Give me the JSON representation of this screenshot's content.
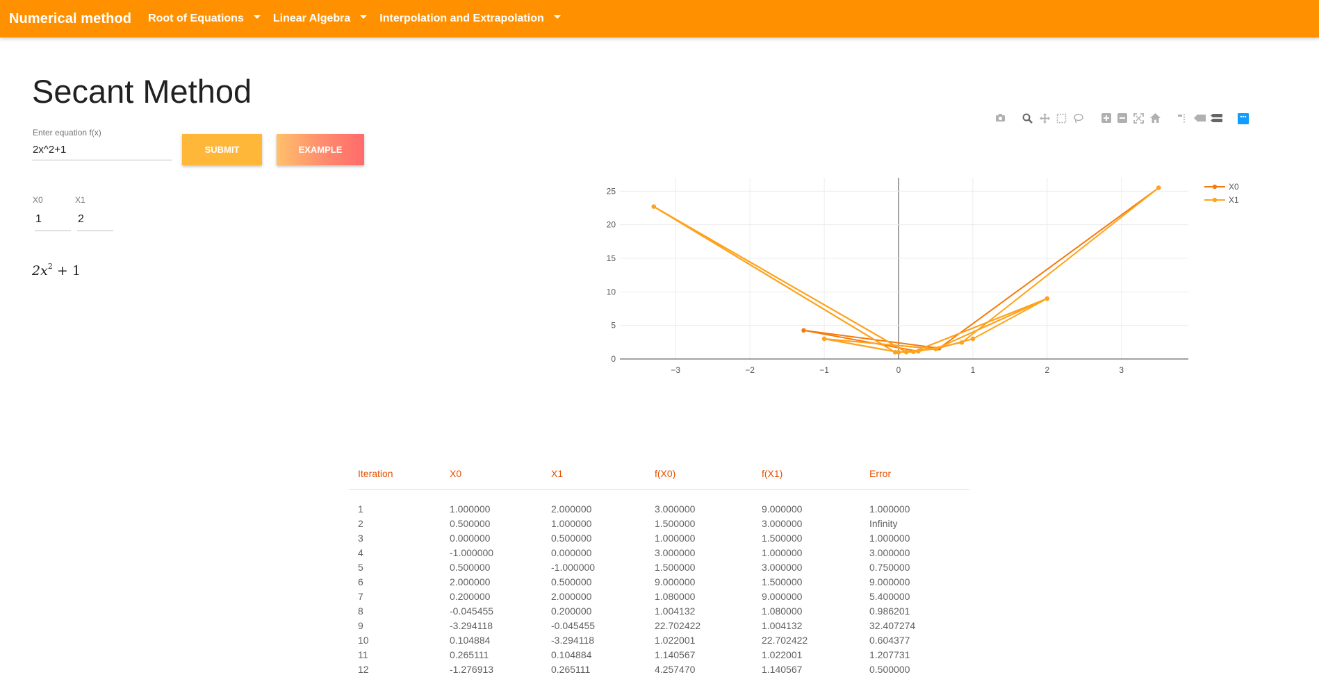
{
  "navbar": {
    "brand": "Numerical method",
    "items": [
      {
        "label": "Root of Equations"
      },
      {
        "label": "Linear Algebra"
      },
      {
        "label": "Interpolation and Extrapolation"
      }
    ]
  },
  "page": {
    "title": "Secant Method"
  },
  "equation": {
    "label": "Enter equation f(x)",
    "value": "2x^2+1",
    "submit_label": "SUBMIT",
    "example_label": "EXAMPLE",
    "rendered": {
      "coef": "2x",
      "exp": "2",
      "rest": "+ 1"
    }
  },
  "initial": {
    "x0_label": "X0",
    "x0_value": "1",
    "x1_label": "X1",
    "x1_value": "2"
  },
  "modebar": {
    "icons": [
      "camera-icon",
      "zoom-icon",
      "pan-icon",
      "box-select-icon",
      "lasso-select-icon",
      "zoom-in-icon",
      "zoom-out-icon",
      "autoscale-icon",
      "reset-axes-icon",
      "spike-lines-icon",
      "hover-closest-icon",
      "hover-compare-icon",
      "plotly-logo-icon"
    ]
  },
  "chart_data": {
    "type": "line",
    "xlim": [
      -3.75,
      3.9
    ],
    "ylim": [
      0,
      27
    ],
    "xticks": [
      -3,
      -2,
      -1,
      0,
      1,
      2,
      3
    ],
    "xtick_labels": [
      "−3",
      "−2",
      "−1",
      "0",
      "1",
      "2",
      "3"
    ],
    "yticks": [
      0,
      5,
      10,
      15,
      20,
      25
    ],
    "grid": true,
    "legend_position": "top-right",
    "series": [
      {
        "name": "X0",
        "color": "#f47a0c",
        "x": [
          1.0,
          0.5,
          0.0,
          -1.0,
          0.5,
          2.0,
          0.2,
          -0.045455,
          -3.294118,
          0.104884,
          0.265111,
          -1.276913,
          0.547,
          3.5
        ],
        "y": [
          3.0,
          1.5,
          1.0,
          3.0,
          1.5,
          9.0,
          1.08,
          1.004132,
          22.702422,
          1.022001,
          1.140567,
          4.26,
          1.6,
          25.5
        ]
      },
      {
        "name": "X1",
        "color": "#ffa31a",
        "x": [
          2.0,
          1.0,
          0.5,
          0.0,
          -1.0,
          0.5,
          2.0,
          0.2,
          -0.045455,
          -3.294118,
          0.104884,
          0.265111,
          0.85,
          3.5
        ],
        "y": [
          9.0,
          3.0,
          1.5,
          1.0,
          3.0,
          1.5,
          9.0,
          1.08,
          1.004132,
          22.702422,
          1.022001,
          1.140567,
          2.45,
          25.5
        ]
      }
    ]
  },
  "table": {
    "headers": [
      "Iteration",
      "X0",
      "X1",
      "f(X0)",
      "f(X1)",
      "Error"
    ],
    "rows": [
      [
        "1",
        "1.000000",
        "2.000000",
        "3.000000",
        "9.000000",
        "1.000000"
      ],
      [
        "2",
        "0.500000",
        "1.000000",
        "1.500000",
        "3.000000",
        "Infinity"
      ],
      [
        "3",
        "0.000000",
        "0.500000",
        "1.000000",
        "1.500000",
        "1.000000"
      ],
      [
        "4",
        "-1.000000",
        "0.000000",
        "3.000000",
        "1.000000",
        "3.000000"
      ],
      [
        "5",
        "0.500000",
        "-1.000000",
        "1.500000",
        "3.000000",
        "0.750000"
      ],
      [
        "6",
        "2.000000",
        "0.500000",
        "9.000000",
        "1.500000",
        "9.000000"
      ],
      [
        "7",
        "0.200000",
        "2.000000",
        "1.080000",
        "9.000000",
        "5.400000"
      ],
      [
        "8",
        "-0.045455",
        "0.200000",
        "1.004132",
        "1.080000",
        "0.986201"
      ],
      [
        "9",
        "-3.294118",
        "-0.045455",
        "22.702422",
        "1.004132",
        "32.407274"
      ],
      [
        "10",
        "0.104884",
        "-3.294118",
        "1.022001",
        "22.702422",
        "0.604377"
      ],
      [
        "11",
        "0.265111",
        "0.104884",
        "1.140567",
        "1.022001",
        "1.207731"
      ],
      [
        "12",
        "-1.276913",
        "0.265111",
        "4.257470",
        "1.140567",
        "0.500000"
      ]
    ]
  }
}
